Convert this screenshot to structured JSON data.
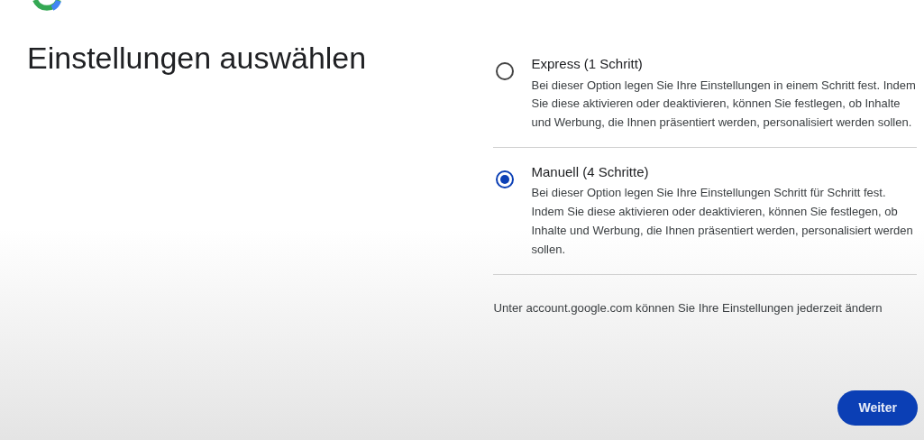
{
  "title": "Einstellungen auswählen",
  "options": [
    {
      "label": "Express (1 Schritt)",
      "description": "Bei dieser Option legen Sie Ihre Einstellungen in einem Schritt fest. Indem Sie diese aktivieren oder deaktivieren, können Sie festlegen, ob Inhalte und Werbung, die Ihnen präsentiert werden, personalisiert werden sollen.",
      "selected": false
    },
    {
      "label": "Manuell (4 Schritte)",
      "description": "Bei dieser Option legen Sie Ihre Einstellungen Schritt für Schritt fest. Indem Sie diese aktivieren oder deaktivieren, können Sie festlegen, ob Inhalte und Werbung, die Ihnen präsentiert werden, personalisiert werden sollen.",
      "selected": true
    }
  ],
  "note": "Unter account.google.com können Sie Ihre Einstellungen jederzeit ändern",
  "button": "Weiter"
}
